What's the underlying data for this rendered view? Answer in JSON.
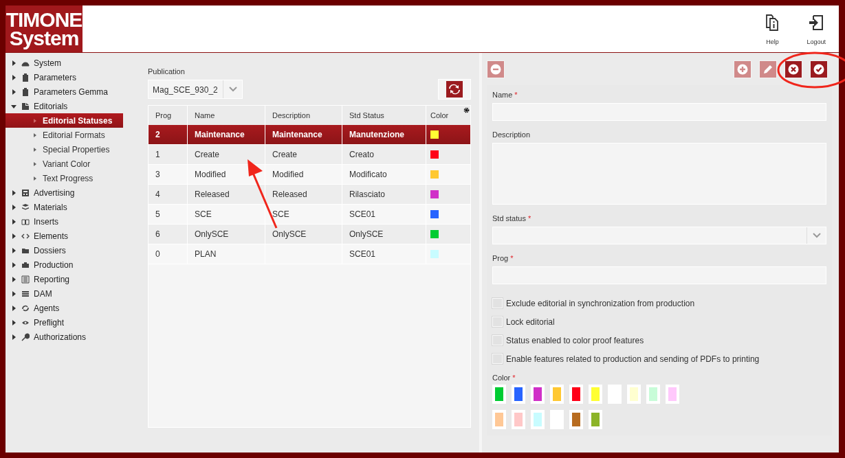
{
  "header": {
    "logo_lines": [
      "TIMONE",
      "System"
    ],
    "actions": [
      {
        "kind": "help",
        "label": "Help"
      },
      {
        "kind": "logout",
        "label": "Logout"
      }
    ]
  },
  "sidebar": {
    "items": [
      {
        "label": "System",
        "expanded": false
      },
      {
        "label": "Parameters",
        "expanded": false
      },
      {
        "label": "Parameters Gemma",
        "expanded": false
      },
      {
        "label": "Editorials",
        "expanded": true,
        "children": [
          {
            "label": "Editorial Statuses",
            "selected": true
          },
          {
            "label": "Editorial Formats",
            "selected": false
          },
          {
            "label": "Special Properties",
            "selected": false
          },
          {
            "label": "Variant Color",
            "selected": false
          },
          {
            "label": "Text Progress",
            "selected": false
          }
        ]
      },
      {
        "label": "Advertising",
        "expanded": false
      },
      {
        "label": "Materials",
        "expanded": false
      },
      {
        "label": "Inserts",
        "expanded": false
      },
      {
        "label": "Elements",
        "expanded": false
      },
      {
        "label": "Dossiers",
        "expanded": false
      },
      {
        "label": "Production",
        "expanded": false
      },
      {
        "label": "Reporting",
        "expanded": false
      },
      {
        "label": "DAM",
        "expanded": false
      },
      {
        "label": "Agents",
        "expanded": false
      },
      {
        "label": "Preflight",
        "expanded": false
      },
      {
        "label": "Authorizations",
        "expanded": false
      }
    ]
  },
  "publication": {
    "label": "Publication",
    "value": "Mag_SCE_930_2"
  },
  "table": {
    "columns": [
      "Prog",
      "Name",
      "Description",
      "Std Status",
      "Color"
    ],
    "rows": [
      {
        "selected": true,
        "prog": "2",
        "name": "Maintenance",
        "description": "Maintenance",
        "std_status": "Manutenzione",
        "color": "#ffff33"
      },
      {
        "selected": false,
        "prog": "1",
        "name": "Create",
        "description": "Create",
        "std_status": "Creato",
        "color": "#ff0018"
      },
      {
        "selected": false,
        "prog": "3",
        "name": "Modified",
        "description": "Modified",
        "std_status": "Modificato",
        "color": "#ffc832"
      },
      {
        "selected": false,
        "prog": "4",
        "name": "Released",
        "description": "Released",
        "std_status": "Rilasciato",
        "color": "#d030c8"
      },
      {
        "selected": false,
        "prog": "5",
        "name": "SCE",
        "description": "SCE",
        "std_status": "SCE01",
        "color": "#2864ff"
      },
      {
        "selected": false,
        "prog": "6",
        "name": "OnlySCE",
        "description": "OnlySCE",
        "std_status": "OnlySCE",
        "color": "#00cc32"
      },
      {
        "selected": false,
        "prog": "0",
        "name": "PLAN",
        "std_status": "SCE01",
        "color": "#c8fcff"
      }
    ]
  },
  "form": {
    "toolbar": [
      {
        "kind": "remove",
        "disabled": true
      },
      {
        "kind": "add",
        "disabled": true
      },
      {
        "kind": "edit",
        "disabled": true
      },
      {
        "kind": "cancel",
        "disabled": false
      },
      {
        "kind": "confirm",
        "disabled": false
      }
    ],
    "fields": [
      {
        "kind": "text",
        "label": "Name",
        "required_mark": "*"
      },
      {
        "kind": "textarea",
        "label": "Description"
      },
      {
        "kind": "select",
        "label": "Std status",
        "required_mark": "*"
      },
      {
        "kind": "text",
        "label": "Prog",
        "required_mark": "*"
      }
    ],
    "checkboxes": [
      {
        "label": "Exclude editorial in synchronization from production",
        "checked": false
      },
      {
        "label": "Lock editorial",
        "checked": false
      },
      {
        "label": "Status enabled to color proof features",
        "checked": false
      },
      {
        "label": "Enable features related to production and sending of PDFs to printing",
        "checked": false
      }
    ],
    "color_label": "Color",
    "color_required_mark": "*",
    "swatch_rows": [
      {
        "swatches": [
          {
            "color": "#00cc32"
          },
          {
            "color": "#2864ff"
          },
          {
            "color": "#d030c8"
          },
          {
            "color": "#ffc832"
          },
          {
            "color": "#ff0018"
          },
          {
            "color": "#ffff33"
          },
          {
            "color": "#ffffff"
          },
          {
            "color": "#ffffd0"
          },
          {
            "color": "#c8fcd8"
          },
          {
            "color": "#ffc8fc"
          }
        ]
      },
      {
        "swatches": [
          {
            "color": "#ffc896"
          },
          {
            "color": "#ffc8c8"
          },
          {
            "color": "#c8fcff"
          },
          {
            "color": "#ffffff"
          },
          {
            "color": "#b86c20"
          },
          {
            "color": "#8cb428"
          }
        ]
      }
    ]
  }
}
